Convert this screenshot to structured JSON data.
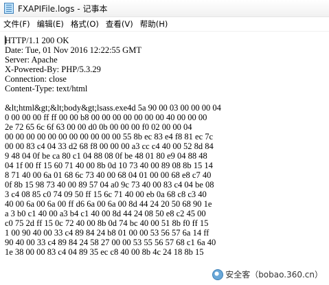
{
  "window": {
    "title": "FXAPIFile.logs - 记事本",
    "icon": "notepad-icon"
  },
  "menu": [
    {
      "label": "文件(F)"
    },
    {
      "label": "编辑(E)"
    },
    {
      "label": "格式(O)"
    },
    {
      "label": "查看(V)"
    },
    {
      "label": "帮助(H)"
    }
  ],
  "editor": {
    "content": "HTTP/1.1 200 OK\nDate: Tue, 01 Nov 2016 12:22:55 GMT\nServer: Apache\nX-Powered-By: PHP/5.3.29\nConnection: close\nContent-Type: text/html\n\n&lt;html&gt;&lt;body&gt;lsass.exe4d 5a 90 00 03 00 00 00 04\n0 00 00 00 ff ff 00 00 b8 00 00 00 00 00 00 00 40 00 00 00\n2e 72 65 6c 6f 63 00 00 d0 0b 00 00 00 f0 02 00 00 04\n00 00 00 00 00 00 00 00 00 00 00 55 8b ec 83 e4 f8 81 ec 7c\n00 00 83 c4 04 33 d2 68 f8 00 00 00 a3 cc c4 40 00 52 8d 84\n9 48 04 0f be ca 80 c1 04 88 08 0f be 48 01 80 e9 04 88 48\n04 1f 00 ff 15 60 71 40 00 8b 0d 10 73 40 00 89 08 8b 15 14\n8 71 40 00 6a 01 68 6c 73 40 00 68 04 01 00 00 68 e8 c7 40\n0f 8b 15 98 73 40 00 89 57 04 a0 9c 73 40 00 83 c4 04 be 08\n3 c4 08 85 c0 74 09 50 ff 15 6c 71 40 00 eb 0a 68 c8 c3 40\n40 00 6a 00 6a 00 ff d6 6a 00 6a 00 8d 44 24 20 50 68 90 1e\na 3 b0 c1 40 00 a3 b4 c1 40 00 8d 44 24 08 50 e8 c2 45 00\nc0 75 2d ff 15 0c 72 40 00 8b 0d 74 bc 40 00 51 8b f0 ff 15\n1 00 90 40 00 33 c4 89 84 24 b8 01 00 00 53 56 57 6a 14 ff\n90 40 00 33 c4 89 84 24 58 27 00 00 53 55 56 57 68 c1 6a 40\n1e 38 00 00 83 c4 04 89 35 ec c8 40 00 8b 4c 24 18 8b 15"
  },
  "watermark": {
    "text": "安全客（bobao.360.cn）"
  }
}
